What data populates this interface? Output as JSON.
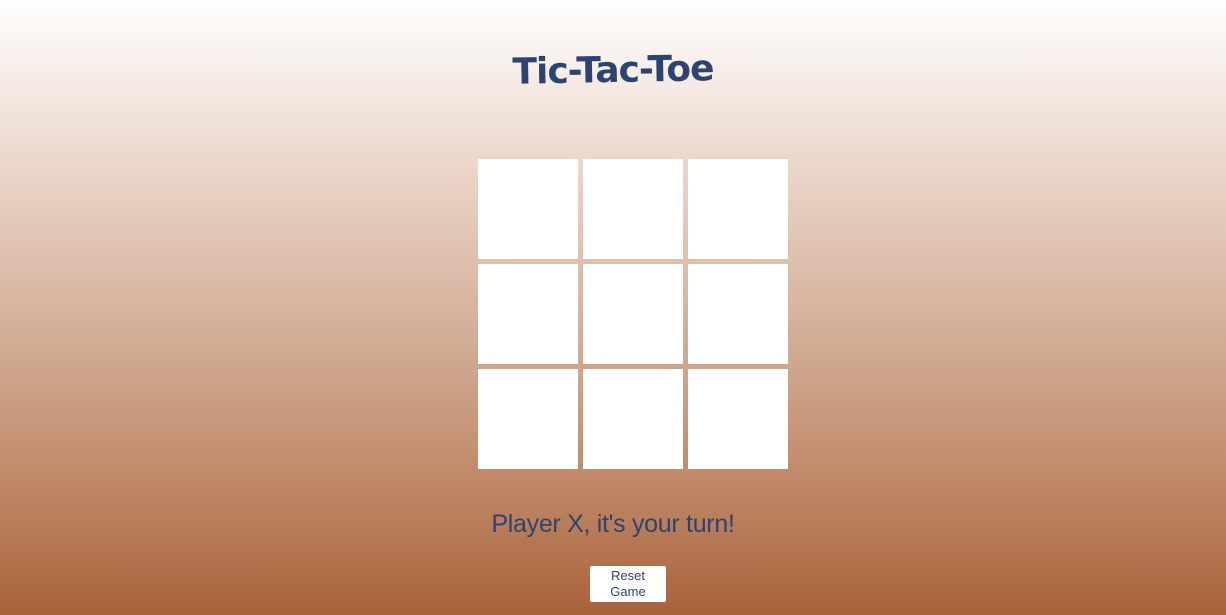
{
  "game": {
    "title": "Tic-Tac-Toe",
    "status": "Player X, it's your turn!",
    "current_player": "X",
    "board": [
      "",
      "",
      "",
      "",
      "",
      "",
      "",
      "",
      ""
    ]
  },
  "controls": {
    "reset_line1": "Reset",
    "reset_line2": "Game"
  },
  "colors": {
    "text": "#2d4470",
    "cell": "#ffffff",
    "gradient_top": "#ffffff",
    "gradient_bottom": "#a8623a"
  }
}
